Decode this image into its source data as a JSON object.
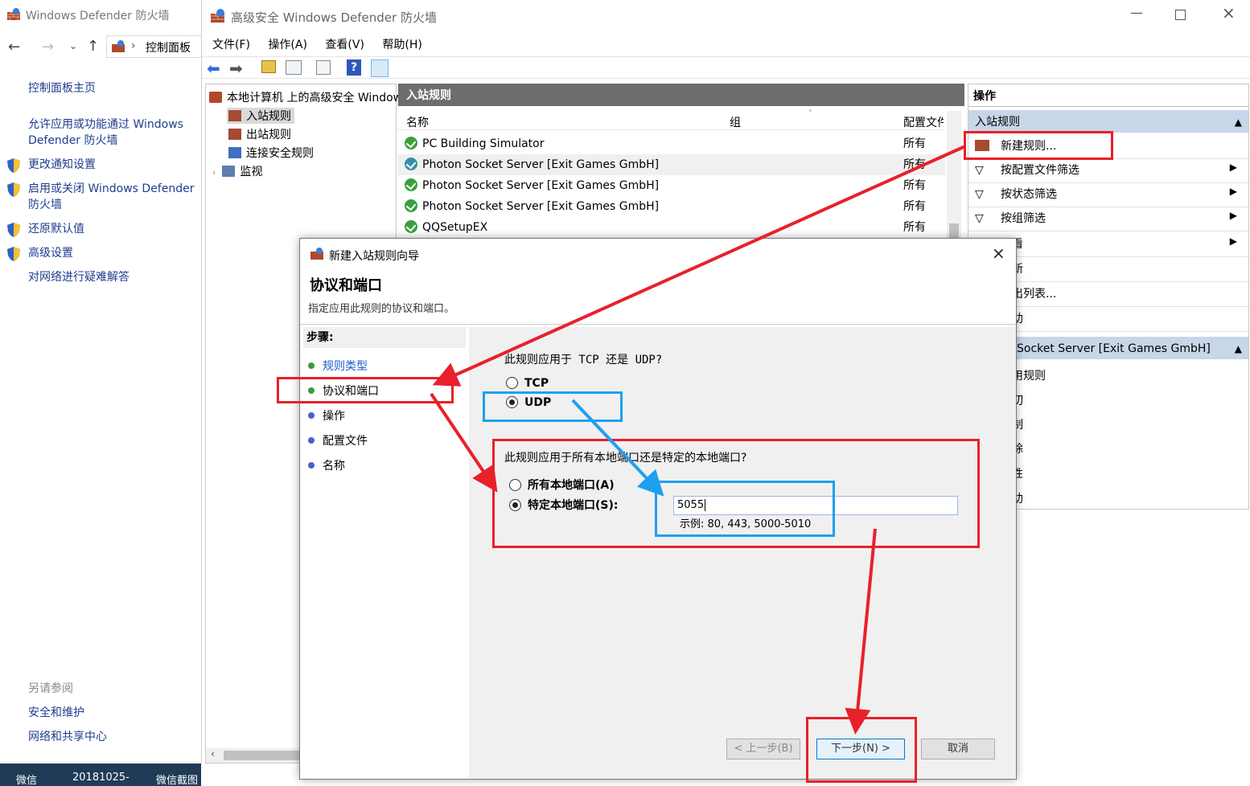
{
  "control_panel": {
    "window_title": "Windows Defender 防火墙",
    "breadcrumb": "控制面板",
    "links": [
      {
        "label": "控制面板主页",
        "shield": false
      },
      {
        "label": "允许应用或功能通过 Windows Defender 防火墙",
        "shield": false
      },
      {
        "label": "更改通知设置",
        "shield": true
      },
      {
        "label": "启用或关闭 Windows Defender 防火墙",
        "shield": true
      },
      {
        "label": "还原默认值",
        "shield": true
      },
      {
        "label": "高级设置",
        "shield": true
      },
      {
        "label": "对网络进行疑难解答",
        "shield": false
      }
    ],
    "see_also_title": "另请参阅",
    "see_also": [
      "安全和维护",
      "网络和共享中心"
    ]
  },
  "taskbar": {
    "items": [
      "微信",
      "20181025-",
      "微信截图"
    ]
  },
  "mmc": {
    "window_title": "高级安全 Windows Defender 防火墙",
    "menu": [
      "文件(F)",
      "操作(A)",
      "查看(V)",
      "帮助(H)"
    ],
    "tree": {
      "root": "本地计算机 上的高级安全 Windows",
      "items": [
        "入站规则",
        "出站规则",
        "连接安全规则",
        "监视"
      ]
    },
    "list": {
      "header": "入站规则",
      "columns": [
        "名称",
        "组",
        "配置文件"
      ],
      "rows": [
        {
          "name": "PC Building Simulator",
          "profile": "所有"
        },
        {
          "name": "Photon Socket Server [Exit Games GmbH]",
          "profile": "所有"
        },
        {
          "name": "Photon Socket Server [Exit Games GmbH]",
          "profile": "所有"
        },
        {
          "name": "Photon Socket Server [Exit Games GmbH]",
          "profile": "所有"
        },
        {
          "name": "QQSetupEX",
          "profile": "所有"
        }
      ]
    },
    "actions": {
      "title": "操作",
      "section1": "入站规则",
      "items1": [
        "新建规则...",
        "按配置文件筛选",
        "按状态筛选",
        "按组筛选",
        "看",
        "新",
        "出列表...",
        "助"
      ],
      "section2": "Socket Server [Exit Games GmbH]",
      "items2": [
        "用规则",
        "切",
        "制",
        "除",
        "性",
        "助"
      ]
    }
  },
  "dialog": {
    "title": "新建入站规则向导",
    "heading": "协议和端口",
    "subheading": "指定应用此规则的协议和端口。",
    "steps_title": "步骤:",
    "steps": [
      {
        "label": "规则类型",
        "color": "#3c9c3c",
        "link": true
      },
      {
        "label": "协议和端口",
        "color": "#3c9c3c",
        "link": false
      },
      {
        "label": "操作",
        "color": "#4a5fc8",
        "link": false
      },
      {
        "label": "配置文件",
        "color": "#4a5fc8",
        "link": false
      },
      {
        "label": "名称",
        "color": "#4a5fc8",
        "link": false
      }
    ],
    "protocol_question": "此规则应用于 TCP 还是 UDP?",
    "tcp_label": "TCP",
    "udp_label": "UDP",
    "port_question": "此规则应用于所有本地端口还是特定的本地端口?",
    "all_ports_label": "所有本地端口(A)",
    "specific_ports_label": "特定本地端口(S):",
    "port_value": "5055",
    "port_example": "示例: 80, 443, 5000-5010",
    "back_button": "< 上一步(B)",
    "next_button": "下一步(N) >",
    "cancel_button": "取消"
  },
  "colors": {
    "annotation_red": "#e8202a",
    "annotation_blue": "#1ea0ef"
  }
}
